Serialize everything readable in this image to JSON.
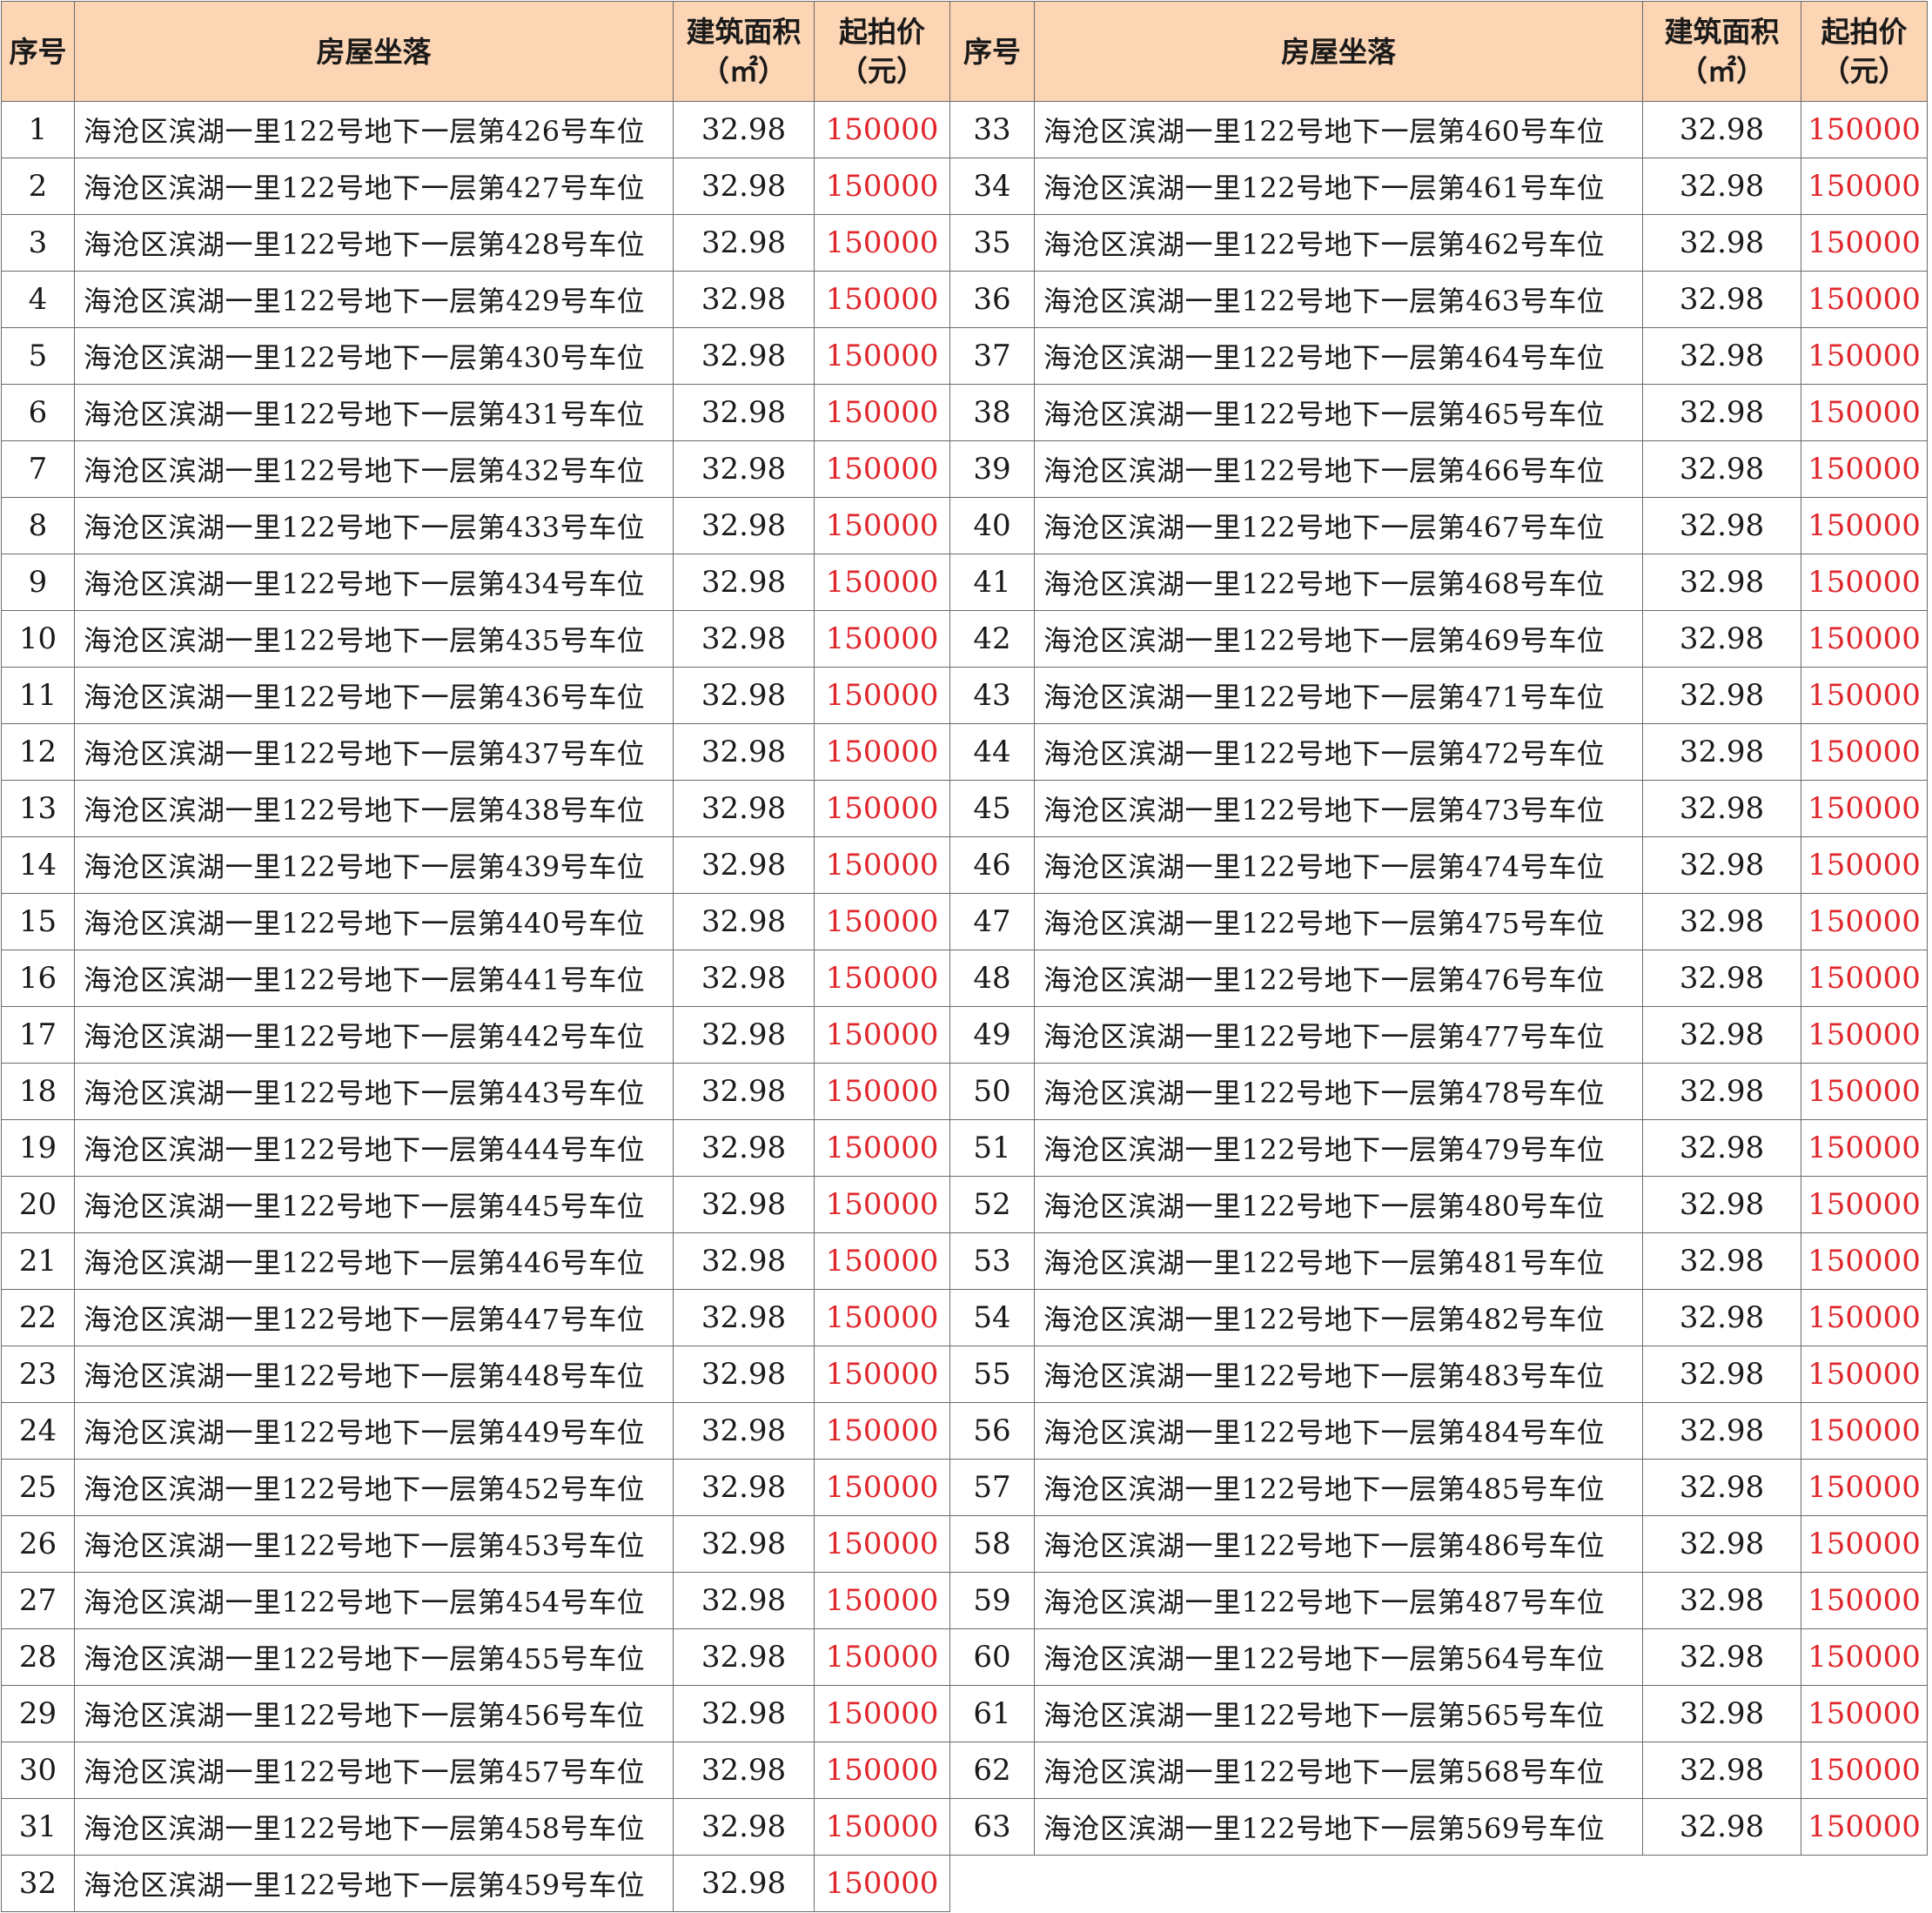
{
  "colors": {
    "header_bg": "#fcd5b4",
    "price_text": "#e0262b",
    "grid_line": "#6a6a6a"
  },
  "header": {
    "seq": "序号",
    "address": "房屋坐落",
    "area_line1": "建筑面积",
    "area_line2": "（㎡）",
    "price_line1": "起拍价",
    "price_line2": "（元）"
  },
  "rows": [
    {
      "left": {
        "seq": "1",
        "address": "海沧区滨湖一里122号地下一层第426号车位",
        "area": "32.98",
        "price": "150000"
      },
      "right": {
        "seq": "33",
        "address": "海沧区滨湖一里122号地下一层第460号车位",
        "area": "32.98",
        "price": "150000"
      }
    },
    {
      "left": {
        "seq": "2",
        "address": "海沧区滨湖一里122号地下一层第427号车位",
        "area": "32.98",
        "price": "150000"
      },
      "right": {
        "seq": "34",
        "address": "海沧区滨湖一里122号地下一层第461号车位",
        "area": "32.98",
        "price": "150000"
      }
    },
    {
      "left": {
        "seq": "3",
        "address": "海沧区滨湖一里122号地下一层第428号车位",
        "area": "32.98",
        "price": "150000"
      },
      "right": {
        "seq": "35",
        "address": "海沧区滨湖一里122号地下一层第462号车位",
        "area": "32.98",
        "price": "150000"
      }
    },
    {
      "left": {
        "seq": "4",
        "address": "海沧区滨湖一里122号地下一层第429号车位",
        "area": "32.98",
        "price": "150000"
      },
      "right": {
        "seq": "36",
        "address": "海沧区滨湖一里122号地下一层第463号车位",
        "area": "32.98",
        "price": "150000"
      }
    },
    {
      "left": {
        "seq": "5",
        "address": "海沧区滨湖一里122号地下一层第430号车位",
        "area": "32.98",
        "price": "150000"
      },
      "right": {
        "seq": "37",
        "address": "海沧区滨湖一里122号地下一层第464号车位",
        "area": "32.98",
        "price": "150000"
      }
    },
    {
      "left": {
        "seq": "6",
        "address": "海沧区滨湖一里122号地下一层第431号车位",
        "area": "32.98",
        "price": "150000"
      },
      "right": {
        "seq": "38",
        "address": "海沧区滨湖一里122号地下一层第465号车位",
        "area": "32.98",
        "price": "150000"
      }
    },
    {
      "left": {
        "seq": "7",
        "address": "海沧区滨湖一里122号地下一层第432号车位",
        "area": "32.98",
        "price": "150000"
      },
      "right": {
        "seq": "39",
        "address": "海沧区滨湖一里122号地下一层第466号车位",
        "area": "32.98",
        "price": "150000"
      }
    },
    {
      "left": {
        "seq": "8",
        "address": "海沧区滨湖一里122号地下一层第433号车位",
        "area": "32.98",
        "price": "150000"
      },
      "right": {
        "seq": "40",
        "address": "海沧区滨湖一里122号地下一层第467号车位",
        "area": "32.98",
        "price": "150000"
      }
    },
    {
      "left": {
        "seq": "9",
        "address": "海沧区滨湖一里122号地下一层第434号车位",
        "area": "32.98",
        "price": "150000"
      },
      "right": {
        "seq": "41",
        "address": "海沧区滨湖一里122号地下一层第468号车位",
        "area": "32.98",
        "price": "150000"
      }
    },
    {
      "left": {
        "seq": "10",
        "address": "海沧区滨湖一里122号地下一层第435号车位",
        "area": "32.98",
        "price": "150000"
      },
      "right": {
        "seq": "42",
        "address": "海沧区滨湖一里122号地下一层第469号车位",
        "area": "32.98",
        "price": "150000"
      }
    },
    {
      "left": {
        "seq": "11",
        "address": "海沧区滨湖一里122号地下一层第436号车位",
        "area": "32.98",
        "price": "150000"
      },
      "right": {
        "seq": "43",
        "address": "海沧区滨湖一里122号地下一层第471号车位",
        "area": "32.98",
        "price": "150000"
      }
    },
    {
      "left": {
        "seq": "12",
        "address": "海沧区滨湖一里122号地下一层第437号车位",
        "area": "32.98",
        "price": "150000"
      },
      "right": {
        "seq": "44",
        "address": "海沧区滨湖一里122号地下一层第472号车位",
        "area": "32.98",
        "price": "150000"
      }
    },
    {
      "left": {
        "seq": "13",
        "address": "海沧区滨湖一里122号地下一层第438号车位",
        "area": "32.98",
        "price": "150000"
      },
      "right": {
        "seq": "45",
        "address": "海沧区滨湖一里122号地下一层第473号车位",
        "area": "32.98",
        "price": "150000"
      }
    },
    {
      "left": {
        "seq": "14",
        "address": "海沧区滨湖一里122号地下一层第439号车位",
        "area": "32.98",
        "price": "150000"
      },
      "right": {
        "seq": "46",
        "address": "海沧区滨湖一里122号地下一层第474号车位",
        "area": "32.98",
        "price": "150000"
      }
    },
    {
      "left": {
        "seq": "15",
        "address": "海沧区滨湖一里122号地下一层第440号车位",
        "area": "32.98",
        "price": "150000"
      },
      "right": {
        "seq": "47",
        "address": "海沧区滨湖一里122号地下一层第475号车位",
        "area": "32.98",
        "price": "150000"
      }
    },
    {
      "left": {
        "seq": "16",
        "address": "海沧区滨湖一里122号地下一层第441号车位",
        "area": "32.98",
        "price": "150000"
      },
      "right": {
        "seq": "48",
        "address": "海沧区滨湖一里122号地下一层第476号车位",
        "area": "32.98",
        "price": "150000"
      }
    },
    {
      "left": {
        "seq": "17",
        "address": "海沧区滨湖一里122号地下一层第442号车位",
        "area": "32.98",
        "price": "150000"
      },
      "right": {
        "seq": "49",
        "address": "海沧区滨湖一里122号地下一层第477号车位",
        "area": "32.98",
        "price": "150000"
      }
    },
    {
      "left": {
        "seq": "18",
        "address": "海沧区滨湖一里122号地下一层第443号车位",
        "area": "32.98",
        "price": "150000"
      },
      "right": {
        "seq": "50",
        "address": "海沧区滨湖一里122号地下一层第478号车位",
        "area": "32.98",
        "price": "150000"
      }
    },
    {
      "left": {
        "seq": "19",
        "address": "海沧区滨湖一里122号地下一层第444号车位",
        "area": "32.98",
        "price": "150000"
      },
      "right": {
        "seq": "51",
        "address": "海沧区滨湖一里122号地下一层第479号车位",
        "area": "32.98",
        "price": "150000"
      }
    },
    {
      "left": {
        "seq": "20",
        "address": "海沧区滨湖一里122号地下一层第445号车位",
        "area": "32.98",
        "price": "150000"
      },
      "right": {
        "seq": "52",
        "address": "海沧区滨湖一里122号地下一层第480号车位",
        "area": "32.98",
        "price": "150000"
      }
    },
    {
      "left": {
        "seq": "21",
        "address": "海沧区滨湖一里122号地下一层第446号车位",
        "area": "32.98",
        "price": "150000"
      },
      "right": {
        "seq": "53",
        "address": "海沧区滨湖一里122号地下一层第481号车位",
        "area": "32.98",
        "price": "150000"
      }
    },
    {
      "left": {
        "seq": "22",
        "address": "海沧区滨湖一里122号地下一层第447号车位",
        "area": "32.98",
        "price": "150000"
      },
      "right": {
        "seq": "54",
        "address": "海沧区滨湖一里122号地下一层第482号车位",
        "area": "32.98",
        "price": "150000"
      }
    },
    {
      "left": {
        "seq": "23",
        "address": "海沧区滨湖一里122号地下一层第448号车位",
        "area": "32.98",
        "price": "150000"
      },
      "right": {
        "seq": "55",
        "address": "海沧区滨湖一里122号地下一层第483号车位",
        "area": "32.98",
        "price": "150000"
      }
    },
    {
      "left": {
        "seq": "24",
        "address": "海沧区滨湖一里122号地下一层第449号车位",
        "area": "32.98",
        "price": "150000"
      },
      "right": {
        "seq": "56",
        "address": "海沧区滨湖一里122号地下一层第484号车位",
        "area": "32.98",
        "price": "150000"
      }
    },
    {
      "left": {
        "seq": "25",
        "address": "海沧区滨湖一里122号地下一层第452号车位",
        "area": "32.98",
        "price": "150000"
      },
      "right": {
        "seq": "57",
        "address": "海沧区滨湖一里122号地下一层第485号车位",
        "area": "32.98",
        "price": "150000"
      }
    },
    {
      "left": {
        "seq": "26",
        "address": "海沧区滨湖一里122号地下一层第453号车位",
        "area": "32.98",
        "price": "150000"
      },
      "right": {
        "seq": "58",
        "address": "海沧区滨湖一里122号地下一层第486号车位",
        "area": "32.98",
        "price": "150000"
      }
    },
    {
      "left": {
        "seq": "27",
        "address": "海沧区滨湖一里122号地下一层第454号车位",
        "area": "32.98",
        "price": "150000"
      },
      "right": {
        "seq": "59",
        "address": "海沧区滨湖一里122号地下一层第487号车位",
        "area": "32.98",
        "price": "150000"
      }
    },
    {
      "left": {
        "seq": "28",
        "address": "海沧区滨湖一里122号地下一层第455号车位",
        "area": "32.98",
        "price": "150000"
      },
      "right": {
        "seq": "60",
        "address": "海沧区滨湖一里122号地下一层第564号车位",
        "area": "32.98",
        "price": "150000"
      }
    },
    {
      "left": {
        "seq": "29",
        "address": "海沧区滨湖一里122号地下一层第456号车位",
        "area": "32.98",
        "price": "150000"
      },
      "right": {
        "seq": "61",
        "address": "海沧区滨湖一里122号地下一层第565号车位",
        "area": "32.98",
        "price": "150000"
      }
    },
    {
      "left": {
        "seq": "30",
        "address": "海沧区滨湖一里122号地下一层第457号车位",
        "area": "32.98",
        "price": "150000"
      },
      "right": {
        "seq": "62",
        "address": "海沧区滨湖一里122号地下一层第568号车位",
        "area": "32.98",
        "price": "150000"
      }
    },
    {
      "left": {
        "seq": "31",
        "address": "海沧区滨湖一里122号地下一层第458号车位",
        "area": "32.98",
        "price": "150000"
      },
      "right": {
        "seq": "63",
        "address": "海沧区滨湖一里122号地下一层第569号车位",
        "area": "32.98",
        "price": "150000"
      }
    },
    {
      "left": {
        "seq": "32",
        "address": "海沧区滨湖一里122号地下一层第459号车位",
        "area": "32.98",
        "price": "150000"
      },
      "right": null
    }
  ]
}
